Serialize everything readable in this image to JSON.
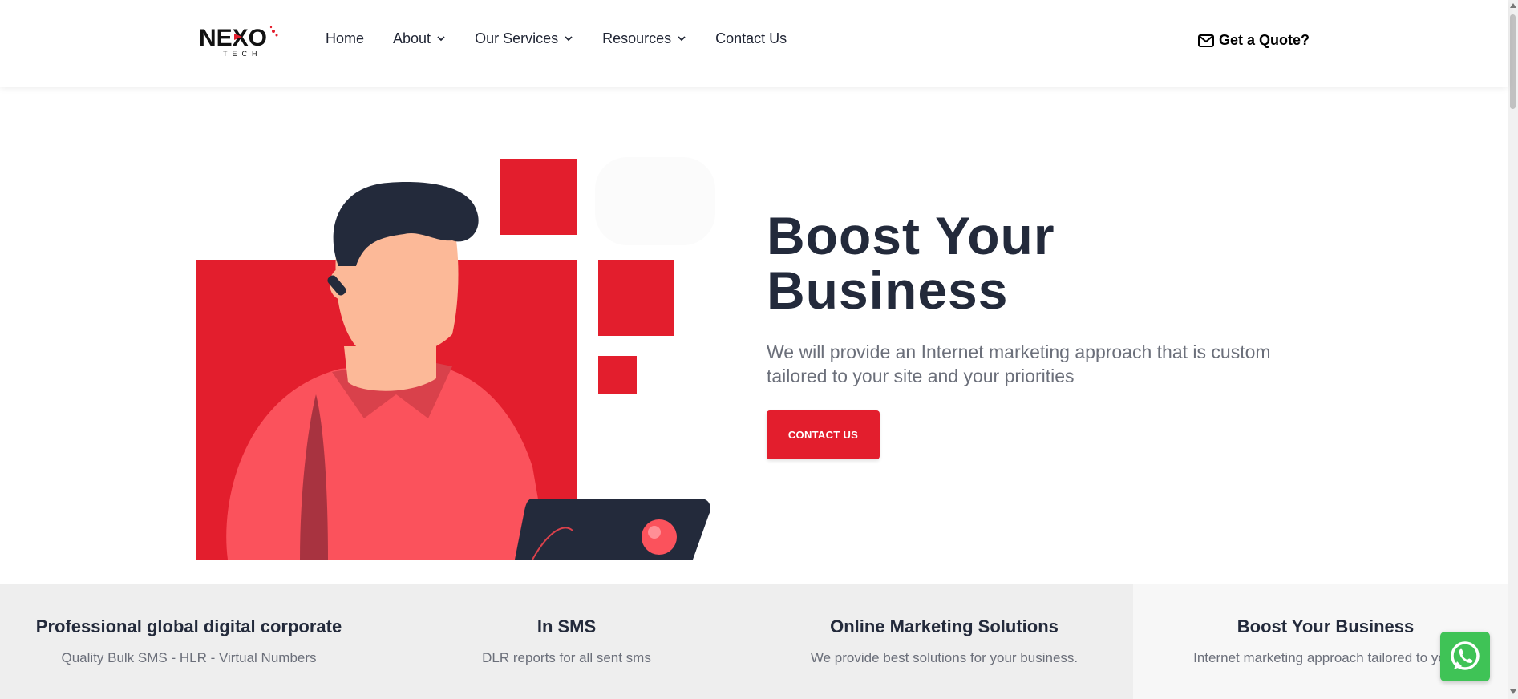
{
  "colors": {
    "accent": "#e31e2d",
    "heading": "#232a3b",
    "body_text": "#6b6f7a",
    "feature_bg": "#eeeeee",
    "whatsapp": "#3fc356"
  },
  "header": {
    "logo": {
      "text": "NEXO",
      "subtext": "TECH",
      "icon": "nexo-tech-logo"
    },
    "nav": [
      {
        "label": "Home",
        "dropdown": false
      },
      {
        "label": "About",
        "dropdown": true
      },
      {
        "label": "Our Services",
        "dropdown": true
      },
      {
        "label": "Resources",
        "dropdown": true
      },
      {
        "label": "Contact Us",
        "dropdown": false
      }
    ],
    "quote": {
      "label": "Get a Quote?",
      "icon": "envelope-icon"
    }
  },
  "hero": {
    "title_line1": "Boost Your",
    "title_line2": "Business",
    "subtitle": "We will provide an Internet marketing approach that is custom tailored to your site and your priorities",
    "cta_label": "CONTACT US",
    "illustration": "man-with-laptop-illustration"
  },
  "features": [
    {
      "title": "Professional global digital corporate",
      "desc": "Quality Bulk SMS - HLR - Virtual Numbers"
    },
    {
      "title": "In SMS",
      "desc": "DLR reports for all sent sms"
    },
    {
      "title": "Online Marketing Solutions",
      "desc": "We provide best solutions for your business."
    },
    {
      "title": "Boost Your Business",
      "desc": "Internet marketing approach tailored to your"
    }
  ],
  "widgets": {
    "whatsapp_icon": "whatsapp-icon"
  }
}
